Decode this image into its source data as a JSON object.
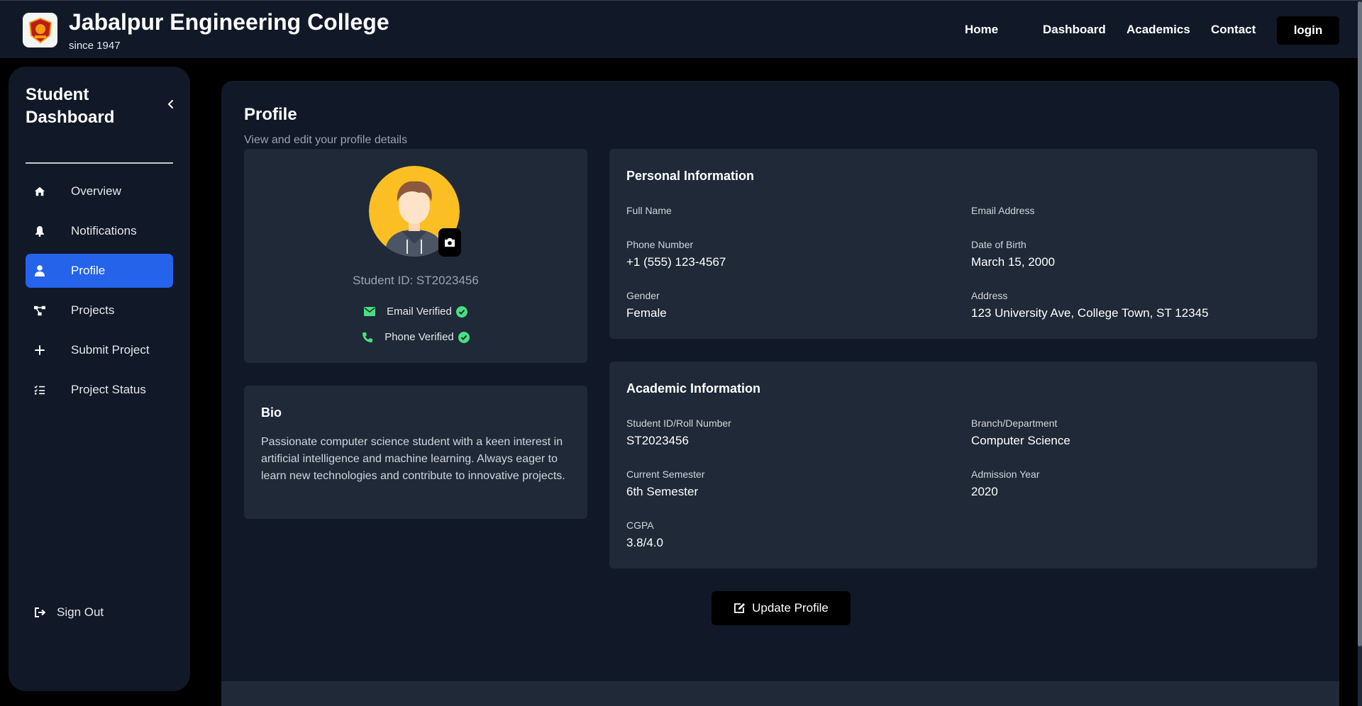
{
  "header": {
    "title": "Jabalpur Engineering College",
    "subtitle": "since 1947",
    "nav": [
      "Home",
      "Dashboard",
      "Academics",
      "Contact"
    ],
    "login_label": "login"
  },
  "sidebar": {
    "title": "Student Dashboard",
    "items": [
      {
        "label": "Overview",
        "icon": "home-icon"
      },
      {
        "label": "Notifications",
        "icon": "bell-icon"
      },
      {
        "label": "Profile",
        "icon": "user-icon",
        "active": true
      },
      {
        "label": "Projects",
        "icon": "project-diagram-icon"
      },
      {
        "label": "Submit Project",
        "icon": "plus-icon"
      },
      {
        "label": "Project Status",
        "icon": "tasks-icon"
      }
    ],
    "signout_label": "Sign Out"
  },
  "profile": {
    "title": "Profile",
    "subtitle": "View and edit your profile details",
    "student_id_text": "Student ID: ST2023456",
    "email_verified": "Email Verified",
    "phone_verified": "Phone Verified"
  },
  "bio": {
    "title": "Bio",
    "text": "Passionate computer science student with a keen interest in artificial intelligence and machine learning. Always eager to learn new technologies and contribute to innovative projects."
  },
  "personal": {
    "title": "Personal Information",
    "fields": [
      {
        "label": "Full Name",
        "value": ""
      },
      {
        "label": "Email Address",
        "value": ""
      },
      {
        "label": "Phone Number",
        "value": "+1 (555) 123-4567"
      },
      {
        "label": "Date of Birth",
        "value": "March 15, 2000"
      },
      {
        "label": "Gender",
        "value": "Female"
      },
      {
        "label": "Address",
        "value": "123 University Ave, College Town, ST 12345"
      }
    ]
  },
  "academic": {
    "title": "Academic Information",
    "fields": [
      {
        "label": "Student ID/Roll Number",
        "value": "ST2023456"
      },
      {
        "label": "Branch/Department",
        "value": "Computer Science"
      },
      {
        "label": "Current Semester",
        "value": "6th Semester"
      },
      {
        "label": "Admission Year",
        "value": "2020"
      },
      {
        "label": "CGPA",
        "value": "3.8/4.0"
      }
    ]
  },
  "update_label": "Update Profile",
  "colors": {
    "page_bg": "#000000",
    "panel_bg": "#111827",
    "card_bg": "#1f2937",
    "accent": "#2563eb",
    "verified": "#4ade80",
    "avatar_bg": "#fbbf24"
  }
}
